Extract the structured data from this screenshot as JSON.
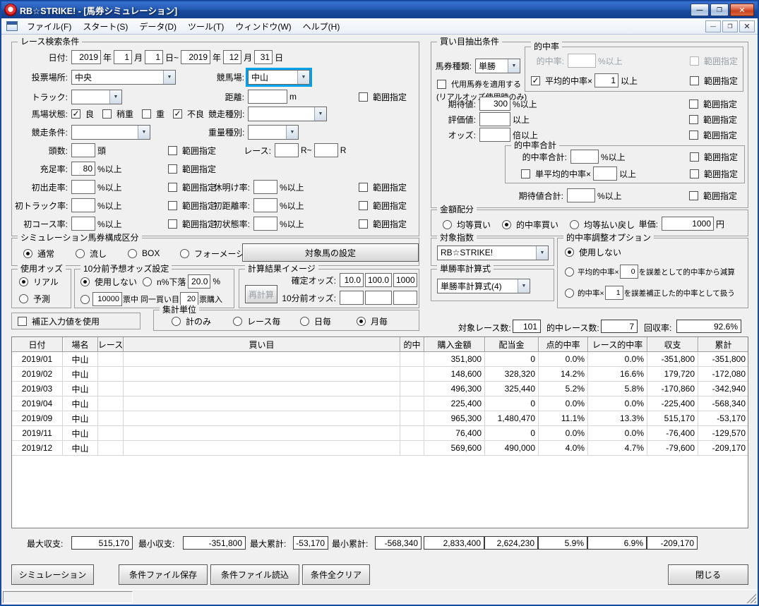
{
  "window": {
    "title": "RB☆STRIKE! - [馬券シミュレーション]",
    "menu": [
      "ファイル(F)",
      "スタート(S)",
      "データ(D)",
      "ツール(T)",
      "ウィンドウ(W)",
      "ヘルプ(H)"
    ],
    "accent_blue": "#1e51ae",
    "highlight_color": "#00a2e8"
  },
  "L": {
    "rng": "範囲指定",
    "pmin": "%以上",
    "min": "以上",
    "bai": "倍以上",
    "yen": "円",
    "m": "m",
    "tou": "頭",
    "R": "R",
    "Rto": "R~",
    "yr": "年",
    "mo": "月",
    "d": "日",
    "dTo": "日~",
    "pct": "%"
  },
  "rs": {
    "cap": "レース検索条件",
    "date": {
      "lb": "日付:",
      "y1": "2019",
      "m1": "1",
      "d1": "1",
      "y2": "2019",
      "m2": "12",
      "d2": "31"
    },
    "vote": {
      "lb": "投票場所:",
      "val": "中央"
    },
    "course": {
      "lb": "競馬場:",
      "val": "中山"
    },
    "track": {
      "lb": "トラック:",
      "val": ""
    },
    "dist": {
      "lb": "距離:",
      "val": ""
    },
    "ground": {
      "lb": "馬場状態:",
      "o1": "良",
      "c1": true,
      "o2": "稍重",
      "c2": false,
      "o3": "重",
      "c3": false,
      "o4": "不良",
      "c4": true
    },
    "rtype": {
      "lb": "競走種別:",
      "val": ""
    },
    "rcond": {
      "lb": "競走条件:",
      "val": ""
    },
    "wtype": {
      "lb": "重量種別:",
      "val": ""
    },
    "heads": {
      "lb": "頭数:",
      "val": ""
    },
    "raceno": {
      "lb": "レース:",
      "v1": "",
      "v2": ""
    },
    "fill": {
      "lb": "充足率:",
      "val": "80"
    },
    "firstrun": {
      "lb": "初出走率:",
      "val": ""
    },
    "rest": {
      "lb": "休明け率:",
      "val": ""
    },
    "ftrack": {
      "lb": "初トラック率:",
      "val": ""
    },
    "fdist": {
      "lb": "初距離率:",
      "val": ""
    },
    "fcourse": {
      "lb": "初コース率:",
      "val": ""
    },
    "fstate": {
      "lb": "初状態率:",
      "val": ""
    }
  },
  "be": {
    "cap": "買い目抽出条件",
    "ticket": {
      "lb": "馬券種類:",
      "val": "単勝"
    },
    "substitute": {
      "lb": "代用馬券を適用する",
      "checked": false,
      "note": "(リアルオッズ使用時のみ)"
    },
    "hit": {
      "cap": "的中率",
      "lb": "的中率:",
      "val": "",
      "avg_lb": "平均的中率×",
      "avg_val": "1",
      "avg_checked": true
    },
    "expect": {
      "lb": "期待値:",
      "val": "300"
    },
    "evalv": {
      "lb": "評価値:",
      "val": ""
    },
    "odds": {
      "lb": "オッズ:",
      "val": ""
    },
    "hitsum": {
      "cap": "的中率合計",
      "lb": "的中率合計:",
      "val": "",
      "avg_lb": "単平均的中率×",
      "avg_val": "",
      "avg_checked": false
    },
    "expectsum": {
      "lb": "期待値合計:",
      "val": ""
    }
  },
  "amt": {
    "cap": "金額配分",
    "o1": "均等買い",
    "s1": false,
    "o2": "的中率買い",
    "s2": true,
    "o3": "均等払い戻し",
    "s3": false,
    "price_lb": "単価:",
    "price": "1000"
  },
  "comp": {
    "cap": "シミュレーション馬券構成区分",
    "o1": "通常",
    "s1": true,
    "o2": "流し",
    "o3": "BOX",
    "o4": "フォーメーション",
    "btn": "対象馬の設定"
  },
  "uo": {
    "cap": "使用オッズ",
    "o1": "リアル",
    "s1": true,
    "o2": "予測"
  },
  "fc": {
    "cap": "10分前予想オッズ設定",
    "o1": "使用しない",
    "s1": true,
    "o2": "n%下落",
    "drop": "20.0",
    "votes": "10000",
    "mid": "票中 同一買い目",
    "buy": "20",
    "end": "票購入"
  },
  "ci": {
    "cap": "計算結果イメージ",
    "btn": "再計算",
    "fixed_lb": "確定オッズ:",
    "f1": "10.0",
    "f2": "100.0",
    "f3": "1000",
    "before_lb": "10分前オッズ:",
    "b1": "",
    "b2": "",
    "b3": ""
  },
  "ti": {
    "cap": "対象指数",
    "val": "RB☆STRIKE!"
  },
  "wf": {
    "cap": "単勝率計算式",
    "val": "単勝率計算式(4)"
  },
  "ha": {
    "cap": "的中率調整オプション",
    "o1": "使用しない",
    "s1": true,
    "o2a": "平均的中率×",
    "o2v": "0",
    "o2b": "を誤差として的中率から減算",
    "o3a": "的中率×",
    "o3v": "1",
    "o3b": "を誤差補正した的中率として扱う"
  },
  "corr": {
    "lb": "補正入力値を使用",
    "checked": false
  },
  "agg": {
    "cap": "集計単位",
    "o1": "計のみ",
    "o2": "レース毎",
    "o3": "日毎",
    "o4": "月毎",
    "s4": true
  },
  "stats": {
    "l1": "対象レース数:",
    "v1": "101",
    "l2": "的中レース数:",
    "v2": "7",
    "l3": "回収率:",
    "v3": "92.6%"
  },
  "table": {
    "columns": [
      "日付",
      "場名",
      "レース",
      "買い目",
      "的中",
      "購入金額",
      "配当金",
      "点的中率",
      "レース的中率",
      "収支",
      "累計"
    ],
    "rows": [
      [
        "2019/01",
        "中山",
        "",
        "",
        "",
        "351,800",
        "0",
        "0.0%",
        "0.0%",
        "-351,800",
        "-351,800"
      ],
      [
        "2019/02",
        "中山",
        "",
        "",
        "",
        "148,600",
        "328,320",
        "14.2%",
        "16.6%",
        "179,720",
        "-172,080"
      ],
      [
        "2019/03",
        "中山",
        "",
        "",
        "",
        "496,300",
        "325,440",
        "5.2%",
        "5.8%",
        "-170,860",
        "-342,940"
      ],
      [
        "2019/04",
        "中山",
        "",
        "",
        "",
        "225,400",
        "0",
        "0.0%",
        "0.0%",
        "-225,400",
        "-568,340"
      ],
      [
        "2019/09",
        "中山",
        "",
        "",
        "",
        "965,300",
        "1,480,470",
        "11.1%",
        "13.3%",
        "515,170",
        "-53,170"
      ],
      [
        "2019/11",
        "中山",
        "",
        "",
        "",
        "76,400",
        "0",
        "0.0%",
        "0.0%",
        "-76,400",
        "-129,570"
      ],
      [
        "2019/12",
        "中山",
        "",
        "",
        "",
        "569,600",
        "490,000",
        "4.0%",
        "4.7%",
        "-79,600",
        "-209,170"
      ]
    ]
  },
  "sum": {
    "l1": "最大収支:",
    "v1": "515,170",
    "l2": "最小収支:",
    "v2": "-351,800",
    "l3": "最大累計:",
    "v3": "-53,170",
    "l4": "最小累計:",
    "v4": "-568,340",
    "t1": "2,833,400",
    "t2": "2,624,230",
    "t3": "5.9%",
    "t4": "6.9%",
    "t5": "-209,170"
  },
  "btns": {
    "sim": "シミュレーション",
    "save": "条件ファイル保存",
    "load": "条件ファイル読込",
    "clear": "条件全クリア",
    "close": "閉じる"
  }
}
